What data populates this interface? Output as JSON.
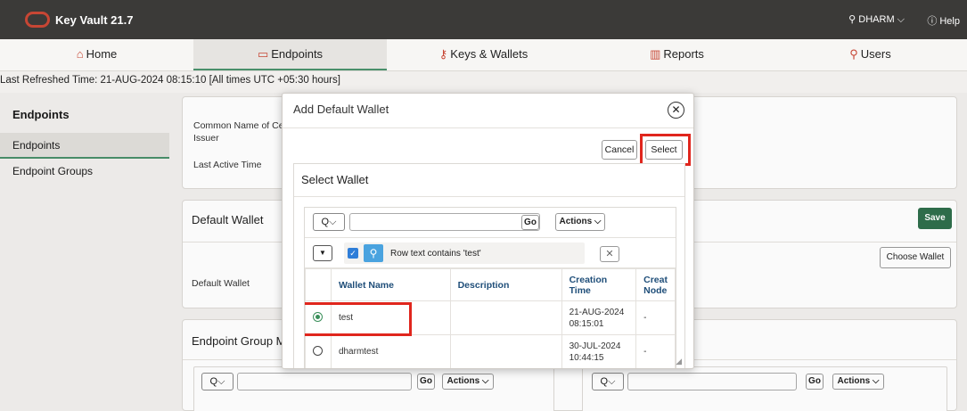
{
  "header": {
    "app_title": "Key Vault 21.7",
    "user_label": "⚲ DHARM ⌵",
    "help_label": "ⓘ Help"
  },
  "nav": {
    "tabs": [
      {
        "icon": "⌂",
        "label": "Home"
      },
      {
        "icon": "▭",
        "label": "Endpoints"
      },
      {
        "icon": "⚷",
        "label": "Keys & Wallets"
      },
      {
        "icon": "▥",
        "label": "Reports"
      },
      {
        "icon": "⚲",
        "label": "Users"
      }
    ]
  },
  "refresh_text": "Last Refreshed Time: 21-AUG-2024 08:15:10 [All times UTC +05:30 hours]",
  "sidebar": {
    "heading": "Endpoints",
    "items": [
      {
        "label": "Endpoints"
      },
      {
        "label": "Endpoint Groups"
      }
    ]
  },
  "details": {
    "common_name_label": "Common Name of Certi",
    "issuer_label": "Issuer",
    "last_active_label": "Last Active Time"
  },
  "default_wallet_panel": {
    "heading": "Default Wallet",
    "field_label": "Default Wallet",
    "save_label": "Save",
    "choose_label": "Choose Wallet"
  },
  "endpoint_group_panel": {
    "heading": "Endpoint Group M",
    "go_label": "Go",
    "actions_label": "Actions ⌵",
    "search_toggle": "Q⌵"
  },
  "modal": {
    "title": "Add Default Wallet",
    "close_icon": "✕",
    "cancel_label": "Cancel",
    "select_label": "Select",
    "region_title": "Select Wallet",
    "search_toggle": "Q⌵",
    "search_value": "",
    "go_label": "Go",
    "actions_label": "Actions ⌵",
    "filter_text": "Row text contains 'test'",
    "filter_clear_icon": "✕",
    "columns": [
      "",
      "Wallet Name",
      "Description",
      "Creation Time",
      "Creat Node"
    ],
    "rows": [
      {
        "selected": true,
        "name": "test",
        "description": "",
        "created_date": "21-AUG-2024",
        "created_time": "08:15:01",
        "node": "-"
      },
      {
        "selected": false,
        "name": "dharmtest",
        "description": "",
        "created_date": "30-JUL-2024",
        "created_time": "10:44:15",
        "node": "-"
      }
    ]
  },
  "colors": {
    "accent": "#2f6f4c",
    "header_bg": "#3b3a38",
    "highlight": "#e0261d",
    "oracle_red": "#c74634"
  }
}
